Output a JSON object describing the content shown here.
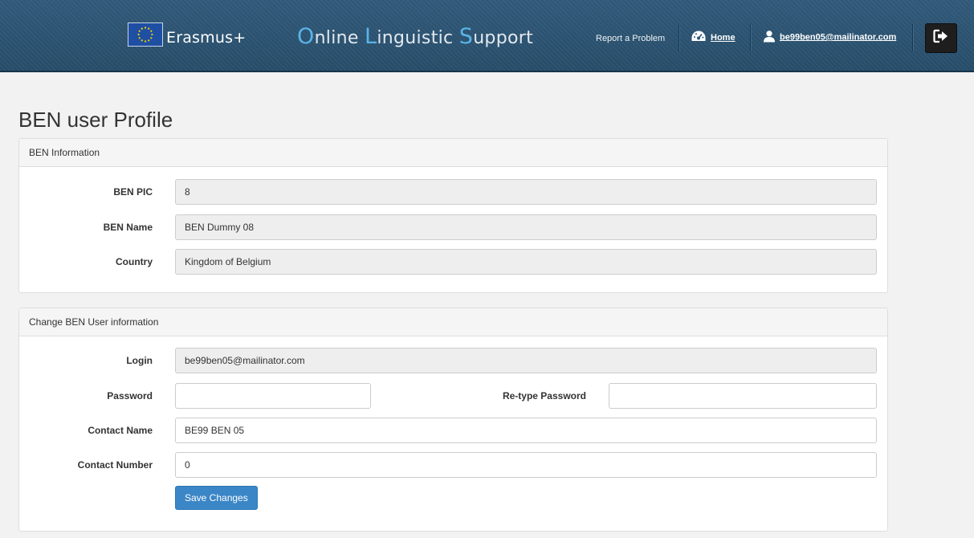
{
  "header": {
    "brand": "Erasmus+",
    "title_parts": [
      {
        "cap": "O",
        "rest": "nline "
      },
      {
        "cap": "L",
        "rest": "inguistic "
      },
      {
        "cap": "S",
        "rest": "upport"
      }
    ],
    "report_label": "Report a Problem",
    "home_label": "Home",
    "user_email": "be99ben05@mailinator.com",
    "icons": {
      "flag": "eu-flag-icon",
      "home": "dashboard-icon",
      "user": "user-icon",
      "logout": "logout-icon"
    },
    "colors": {
      "bar": "#2f5878",
      "accent": "#5ab4e6"
    }
  },
  "page": {
    "title": "BEN user Profile"
  },
  "ben_info": {
    "heading": "BEN Information",
    "pic_label": "BEN PIC",
    "pic_value": "8",
    "name_label": "BEN Name",
    "name_value": "BEN Dummy 08",
    "country_label": "Country",
    "country_value": "Kingdom of Belgium"
  },
  "user_info": {
    "heading": "Change BEN User information",
    "login_label": "Login",
    "login_value": "be99ben05@mailinator.com",
    "password_label": "Password",
    "password_value": "",
    "retype_label": "Re-type Password",
    "retype_value": "",
    "contact_name_label": "Contact Name",
    "contact_name_value": "BE99 BEN 05",
    "contact_number_label": "Contact Number",
    "contact_number_value": "0",
    "save_label": "Save Changes",
    "colors": {
      "primary": "#3b86c7"
    }
  }
}
